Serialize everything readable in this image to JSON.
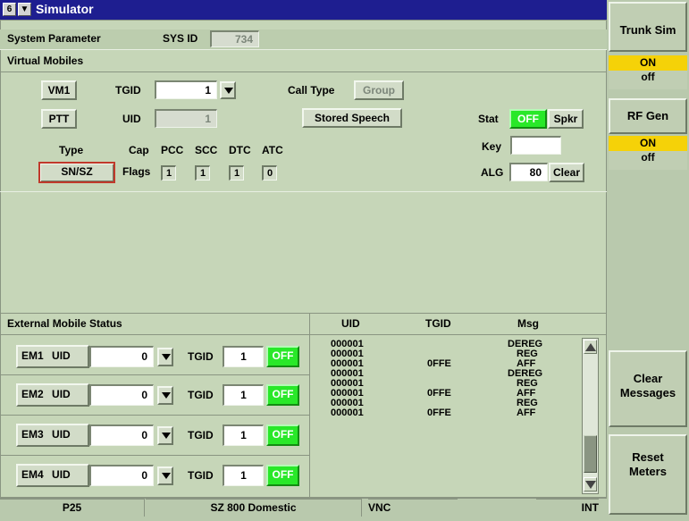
{
  "window": {
    "title": "Simulator",
    "menu_icon": "6",
    "dropdown_icon": "▼"
  },
  "system_parameter": {
    "label": "System Parameter",
    "sysid_label": "SYS ID",
    "sysid_value": "734"
  },
  "virtual_mobiles": {
    "header": "Virtual Mobiles",
    "vm_button": "VM1",
    "tgid_label": "TGID",
    "tgid_value": "1",
    "call_type_label": "Call Type",
    "call_type_value": "Group",
    "ptt_button": "PTT",
    "uid_label": "UID",
    "uid_value": "1",
    "stored_speech_button": "Stored Speech",
    "stat_label": "Stat",
    "stat_value": "OFF",
    "spkr_button": "Spkr",
    "type_label": "Type",
    "type_value": "SN/SZ",
    "cap_label": "Cap",
    "flags_label": "Flags",
    "flag_headers": [
      "PCC",
      "SCC",
      "DTC",
      "ATC"
    ],
    "flag_values": [
      "1",
      "1",
      "1",
      "0"
    ],
    "key_label": "Key",
    "key_value": "",
    "alg_label": "ALG",
    "alg_value": "80",
    "clear_button": "Clear"
  },
  "external_mobiles": {
    "header": "External Mobile Status",
    "rows": [
      {
        "em": "EM1",
        "uid_label": "UID",
        "uid": "0",
        "tgid_label": "TGID",
        "tgid": "1",
        "status": "OFF"
      },
      {
        "em": "EM2",
        "uid_label": "UID",
        "uid": "0",
        "tgid_label": "TGID",
        "tgid": "1",
        "status": "OFF"
      },
      {
        "em": "EM3",
        "uid_label": "UID",
        "uid": "0",
        "tgid_label": "TGID",
        "tgid": "1",
        "status": "OFF"
      },
      {
        "em": "EM4",
        "uid_label": "UID",
        "uid": "0",
        "tgid_label": "TGID",
        "tgid": "1",
        "status": "OFF"
      }
    ]
  },
  "messages": {
    "headers": [
      "UID",
      "TGID",
      "Msg"
    ],
    "rows": [
      {
        "uid": "000001",
        "tgid": "",
        "msg": "DEREG"
      },
      {
        "uid": "000001",
        "tgid": "",
        "msg": "REG"
      },
      {
        "uid": "000001",
        "tgid": "0FFE",
        "msg": "AFF"
      },
      {
        "uid": "000001",
        "tgid": "",
        "msg": "DEREG"
      },
      {
        "uid": "000001",
        "tgid": "",
        "msg": "REG"
      },
      {
        "uid": "000001",
        "tgid": "0FFE",
        "msg": "AFF"
      },
      {
        "uid": "000001",
        "tgid": "",
        "msg": "REG"
      },
      {
        "uid": "000001",
        "tgid": "0FFE",
        "msg": "AFF"
      }
    ]
  },
  "softkeys": {
    "trunk_sim": "Trunk Sim",
    "trunk_on": "ON",
    "trunk_off": "off",
    "rf_gen": "RF Gen",
    "rf_on": "ON",
    "rf_off": "off",
    "clear_messages_1": "Clear",
    "clear_messages_2": "Messages",
    "reset_meters_1": "Reset",
    "reset_meters_2": "Meters"
  },
  "status_bar": {
    "protocol": "P25",
    "system": "SZ 800 Domestic",
    "connection": "VNC",
    "reference": "INT"
  },
  "colors": {
    "title_bar": "#1e1e90",
    "panel": "#c6d6b8",
    "status_off": "#29e829",
    "soft_on": "#f5d208",
    "type_border": "#c0392b"
  }
}
